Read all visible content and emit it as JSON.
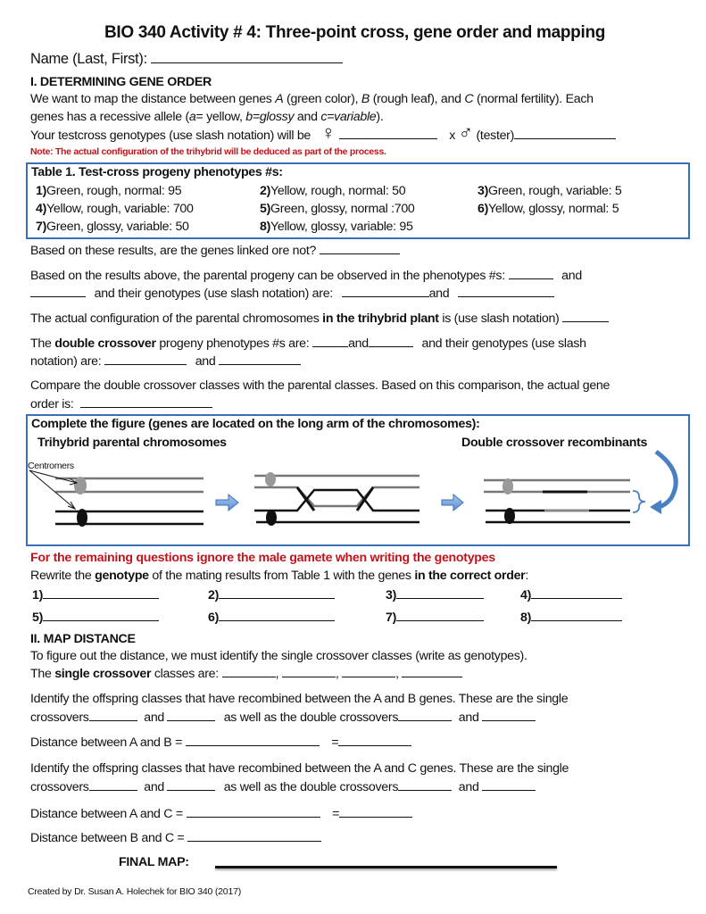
{
  "title": "BIO 340 Activity # 4: Three-point cross, gene order and mapping",
  "name_label": "Name (Last, First):",
  "section1": {
    "heading": "I. DETERMINING GENE ORDER",
    "intro_1a": "We want to map the distance between genes ",
    "gene_a": "A",
    "intro_1b": " (green color), ",
    "gene_b": "B",
    "intro_1c": " (rough leaf), and ",
    "gene_c": "C",
    "intro_1d": " (normal fertility). Each",
    "intro_2a": "genes has a recessive allele (",
    "allele_a": "a",
    "intro_2b": "= yellow, ",
    "allele_b": "b=glossy",
    "intro_2c": " and ",
    "allele_c": "c=variable",
    "intro_2d": ").",
    "testcross_label": "Your testcross genotypes (use slash notation) will be",
    "female_symbol": "♀",
    "cross_x": "x",
    "male_symbol": "♂",
    "tester_label": "(tester)",
    "note": "Note: The actual configuration of the trihybrid will be deduced as part of the process."
  },
  "table1": {
    "title": "Table 1. Test-cross progeny phenotypes #s:",
    "items": [
      {
        "num": "1)",
        "text": "Green, rough, normal: 95"
      },
      {
        "num": "2)",
        "text": "Yellow, rough, normal: 50"
      },
      {
        "num": "3)",
        "text": "Green, rough, variable: 5"
      },
      {
        "num": "4)",
        "text": "Yellow, rough, variable: 700"
      },
      {
        "num": "5)",
        "text": "Green, glossy, normal :700"
      },
      {
        "num": "6)",
        "text": "Yellow, glossy, normal: 5"
      },
      {
        "num": "7)",
        "text": "Green, glossy, variable: 50"
      },
      {
        "num": "8)",
        "text": "Yellow, glossy, variable: 95"
      }
    ]
  },
  "questions": {
    "linked": "Based on these results, are the genes linked ore not?",
    "parental_1": "Based on the results above, the parental progeny can be observed in the phenotypes #s:",
    "and": "and",
    "parental_2": "and their genotypes (use slash notation) are:",
    "config_a": "The actual configuration of the parental chromosomes ",
    "config_b": "in the trihybrid plant",
    "config_c": " is (use slash notation)",
    "dco_a": "The ",
    "dco_b": "double crossover",
    "dco_c": " progeny phenotypes #s are:",
    "dco_d": "and their genotypes (use slash",
    "dco_e": "notation) are:",
    "compare_1": "Compare the double crossover classes with the parental classes.  Based on this comparison, the actual gene",
    "compare_2": "order is:"
  },
  "figure": {
    "title": "Complete the figure (genes are located on the long arm of the chromosomes):",
    "left_label": "Trihybrid parental chromosomes",
    "right_label": "Double crossover recombinants",
    "centromers_label": "Centromers"
  },
  "part2": {
    "red_note": "For the remaining questions ignore the male gamete when writing the genotypes",
    "rewrite_a": "Rewrite the ",
    "rewrite_b": "genotype",
    "rewrite_c": " of the mating results from Table 1 with the genes ",
    "rewrite_d": "in the correct order",
    "rewrite_e": ":",
    "answer_nums": [
      "1)",
      "2)",
      "3)",
      "4)",
      "5)",
      "6)",
      "7)",
      "8)"
    ]
  },
  "section2": {
    "heading": "II. MAP DISTANCE",
    "intro": "To figure out the distance, we must identify the single crossover classes (write as genotypes).",
    "sco_a": "The ",
    "sco_b": "single crossover",
    "sco_c": " classes are:",
    "ab_1": "Identify the offspring classes that have recombined between the A and B genes. These are the single",
    "ac_1": "Identify the offspring classes that have recombined between the A and C genes. These are the single",
    "crossovers": "crossovers",
    "and": "and",
    "as_well": "as well as the double crossovers",
    "dist_ab": "Distance between A and B =",
    "dist_ac": "Distance between A and C =",
    "dist_bc": "Distance between B and C =",
    "equals": "=",
    "final_map": "FINAL MAP:"
  },
  "footer": "Created by Dr. Susan A. Holechek for BIO 340 (2017)"
}
